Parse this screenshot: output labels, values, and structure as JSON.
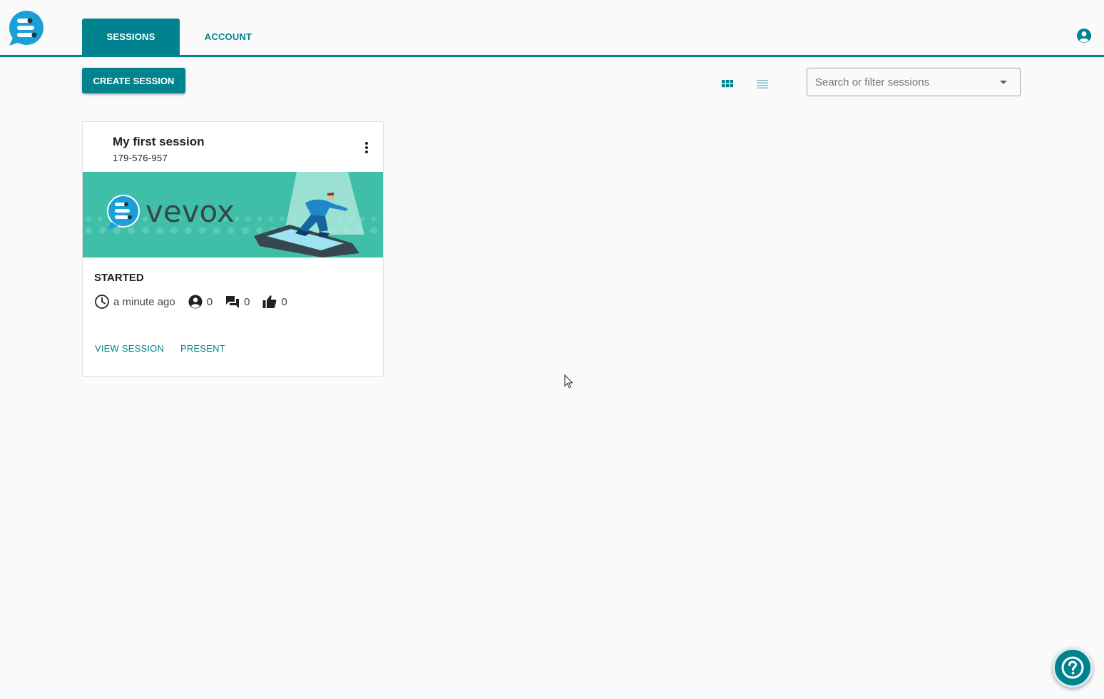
{
  "header": {
    "tabs": [
      {
        "label": "SESSIONS",
        "active": true
      },
      {
        "label": "ACCOUNT",
        "active": false
      }
    ]
  },
  "toolbar": {
    "create_label": "CREATE SESSION",
    "search_placeholder": "Search or filter sessions"
  },
  "session": {
    "title": "My first session",
    "code": "179-576-957",
    "banner_brand": "vevox",
    "status": "STARTED",
    "time": "a minute ago",
    "participants": "0",
    "messages": "0",
    "likes": "0",
    "view_label": "VIEW SESSION",
    "present_label": "PRESENT"
  },
  "colors": {
    "primary": "#00838f",
    "banner": "#40bfa8",
    "logo": "#1aa0d8"
  },
  "icons": {
    "logo": "vevox-logo-icon",
    "account": "account-circle-icon",
    "grid_view": "grid-view-icon",
    "list_view": "list-view-icon",
    "dropdown": "caret-down-icon",
    "menu": "more-vert-icon",
    "time": "clock-icon",
    "participants": "person-icon",
    "messages": "chat-icon",
    "likes": "thumb-up-icon",
    "help": "help-icon"
  }
}
